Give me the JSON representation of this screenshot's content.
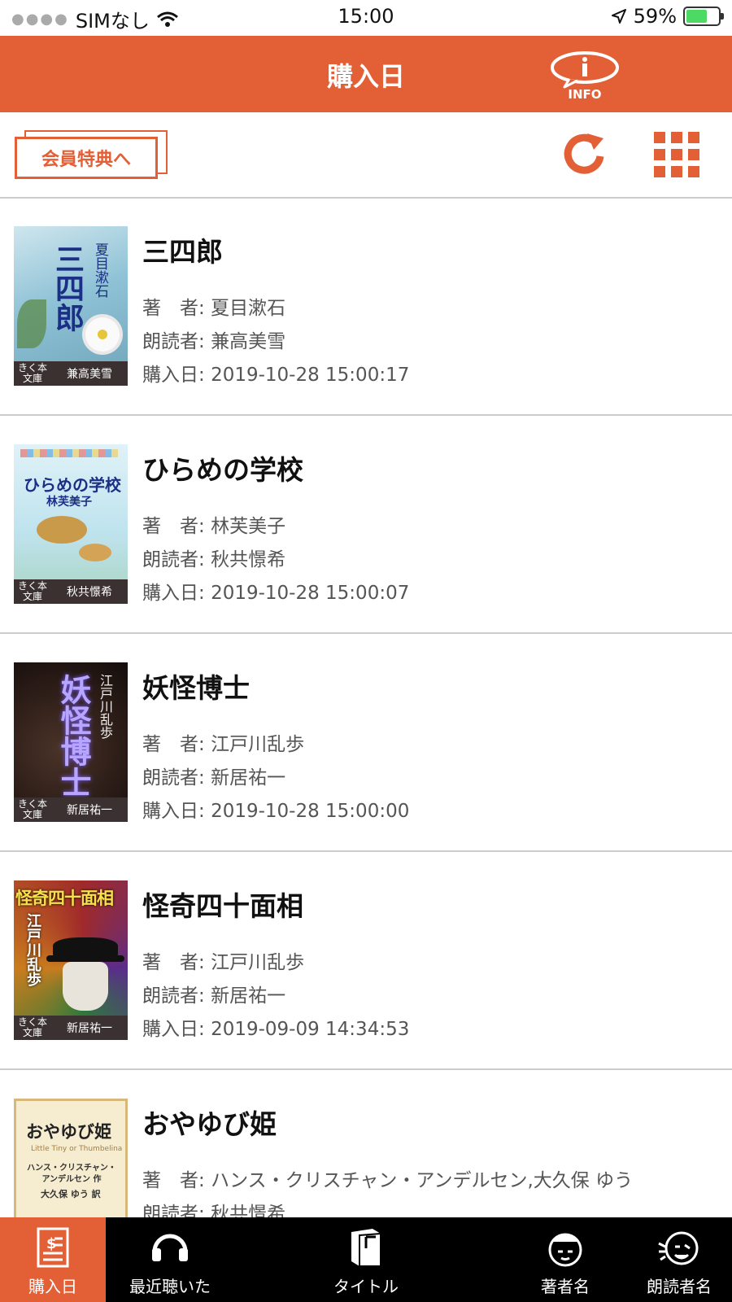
{
  "status_bar": {
    "carrier": "SIMなし",
    "time": "15:00",
    "battery": "59%"
  },
  "nav": {
    "title": "購入日",
    "info_label": "INFO"
  },
  "toolbar": {
    "member_button": "会員特典へ"
  },
  "colors": {
    "accent": "#e35f36",
    "tab_bar": "#000000"
  },
  "books": [
    {
      "title": "三四郎",
      "author_label": "著　者:",
      "author": "夏目漱石",
      "reader_label": "朗読者:",
      "reader": "兼高美雪",
      "date_label": "購入日:",
      "date": "2019-10-28 15:00:17",
      "cover": {
        "title": "三四郎",
        "author": "夏目漱石",
        "lib": "きく本文庫",
        "reader": "兼高美雪"
      }
    },
    {
      "title": "ひらめの学校",
      "author_label": "著　者:",
      "author": "林芙美子",
      "reader_label": "朗読者:",
      "reader": "秋共憬希",
      "date_label": "購入日:",
      "date": "2019-10-28 15:00:07",
      "cover": {
        "title": "ひらめの学校",
        "author": "林芙美子",
        "lib": "きく本文庫",
        "reader": "秋共憬希"
      }
    },
    {
      "title": "妖怪博士",
      "author_label": "著　者:",
      "author": "江戸川乱歩",
      "reader_label": "朗読者:",
      "reader": "新居祐一",
      "date_label": "購入日:",
      "date": "2019-10-28 15:00:00",
      "cover": {
        "title": "妖怪博士",
        "author": "江戸川乱歩",
        "lib": "きく本文庫",
        "reader": "新居祐一"
      }
    },
    {
      "title": "怪奇四十面相",
      "author_label": "著　者:",
      "author": "江戸川乱歩",
      "reader_label": "朗読者:",
      "reader": "新居祐一",
      "date_label": "購入日:",
      "date": "2019-09-09 14:34:53",
      "cover": {
        "title": "怪奇四十面相",
        "author": "江戸川乱歩",
        "lib": "きく本文庫",
        "reader": "新居祐一"
      }
    },
    {
      "title": "おやゆび姫",
      "author_label": "著　者:",
      "author": "ハンス・クリスチャン・アンデルセン,大久保 ゆう",
      "reader_label": "朗読者:",
      "reader": "秋共憬希",
      "date_label": "",
      "date": "",
      "cover": {
        "title": "おやゆび姫",
        "subtitle": "Little Tiny or Thumbelina",
        "author": "ハンス・クリスチャン・アンデルセン 作",
        "translator": "大久保 ゆう 訳"
      }
    }
  ],
  "tabs": [
    {
      "label": "購入日",
      "icon": "receipt-icon"
    },
    {
      "label": "最近聴いた",
      "icon": "headphones-icon"
    },
    {
      "label": "タイトル",
      "icon": "book-icon"
    },
    {
      "label": "著者名",
      "icon": "author-face-icon"
    },
    {
      "label": "朗読者名",
      "icon": "reader-face-icon"
    }
  ]
}
